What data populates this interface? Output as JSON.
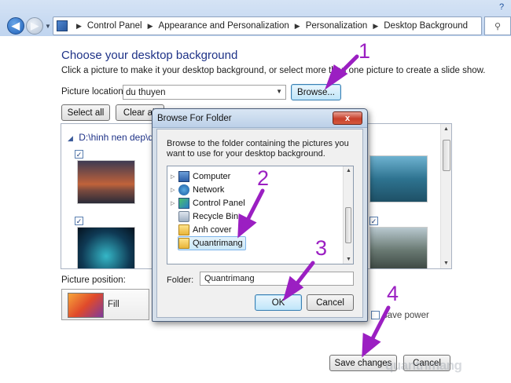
{
  "address": {
    "crumbs": [
      "Control Panel",
      "Appearance and Personalization",
      "Personalization",
      "Desktop Background"
    ],
    "help": "?"
  },
  "main": {
    "title": "Choose your desktop background",
    "description": "Click a picture to make it your desktop background, or select more than one picture to create a slide show.",
    "location_label": "Picture location:",
    "location_value": "du thuyen",
    "browse_label": "Browse...",
    "select_all_label": "Select all",
    "clear_all_label": "Clear all",
    "folder_path": "D:\\hinh nen dep\\du",
    "position_label": "Picture position:",
    "position_value": "Fill",
    "save_power_label": "save power",
    "save_changes_label": "Save changes",
    "cancel_label": "Cancel"
  },
  "dialog": {
    "title": "Browse For Folder",
    "close": "x",
    "instructions": "Browse to the folder containing the pictures you want to use for your desktop background.",
    "tree": [
      {
        "label": "Computer",
        "icon": "computer-icon",
        "expandable": true
      },
      {
        "label": "Network",
        "icon": "network-icon",
        "expandable": true
      },
      {
        "label": "Control Panel",
        "icon": "control-panel-icon",
        "expandable": true
      },
      {
        "label": "Recycle Bin",
        "icon": "recycle-bin-icon",
        "expandable": false
      },
      {
        "label": "Anh cover",
        "icon": "folder-icon",
        "expandable": false
      },
      {
        "label": "Quantrimang",
        "icon": "folder-icon",
        "expandable": false,
        "selected": true
      }
    ],
    "folder_label": "Folder:",
    "folder_value": "Quantrimang",
    "ok_label": "OK",
    "cancel_label": "Cancel"
  },
  "annotations": [
    "1",
    "2",
    "3",
    "4"
  ],
  "watermark": "quantrimang",
  "colors": {
    "annotation": "#9b1fc2",
    "title_blue": "#1e3287",
    "close_red": "#c7402b"
  }
}
